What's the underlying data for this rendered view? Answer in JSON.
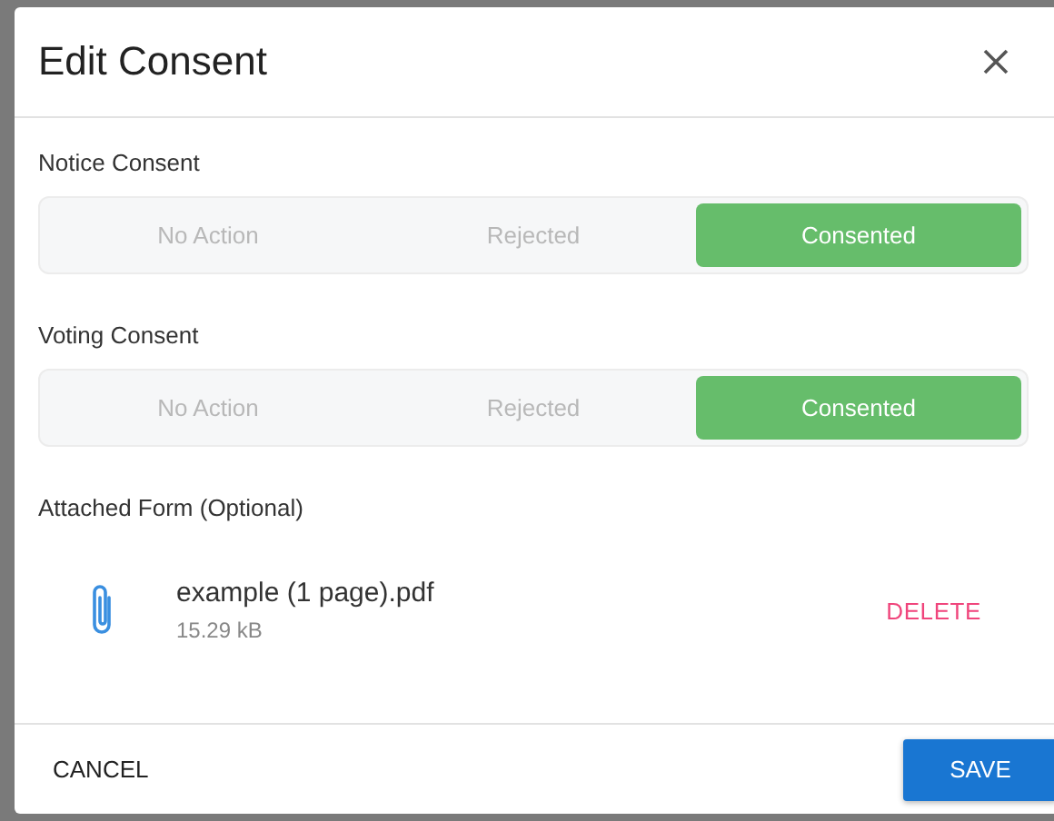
{
  "dialog": {
    "title": "Edit Consent"
  },
  "consents": [
    {
      "label": "Notice Consent",
      "options": [
        {
          "label": "No Action",
          "selected": false
        },
        {
          "label": "Rejected",
          "selected": false
        },
        {
          "label": "Consented",
          "selected": true
        }
      ]
    },
    {
      "label": "Voting Consent",
      "options": [
        {
          "label": "No Action",
          "selected": false
        },
        {
          "label": "Rejected",
          "selected": false
        },
        {
          "label": "Consented",
          "selected": true
        }
      ]
    }
  ],
  "attachment": {
    "label": "Attached Form (Optional)",
    "file_name": "example (1 page).pdf",
    "file_size": "15.29 kB",
    "delete": "DELETE"
  },
  "buttons": {
    "cancel": "CANCEL",
    "save": "SAVE"
  }
}
